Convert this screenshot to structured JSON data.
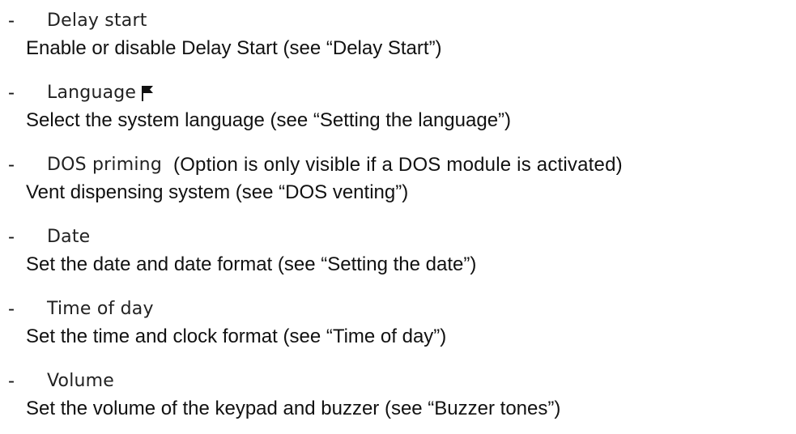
{
  "items": [
    {
      "dash": "-",
      "term": "Delay start",
      "description": "Enable or disable Delay Start (see “Delay Start”)"
    },
    {
      "dash": "-",
      "term": "Language",
      "icon": "flag-icon",
      "description": "Select the system language (see “Setting the language”)"
    },
    {
      "dash": "-",
      "term": "DOS priming",
      "note": "(Option is only visible if a DOS module is activated)",
      "description": "Vent dispensing system (see “DOS venting”)"
    },
    {
      "dash": "-",
      "term": "Date",
      "description": "Set the date and date format (see “Setting the date”)"
    },
    {
      "dash": "-",
      "term": "Time of day",
      "description": "Set the time and clock format (see “Time of day”)"
    },
    {
      "dash": "-",
      "term": "Volume",
      "description": "Set the volume of the keypad and buzzer (see “Buzzer tones”)"
    }
  ]
}
